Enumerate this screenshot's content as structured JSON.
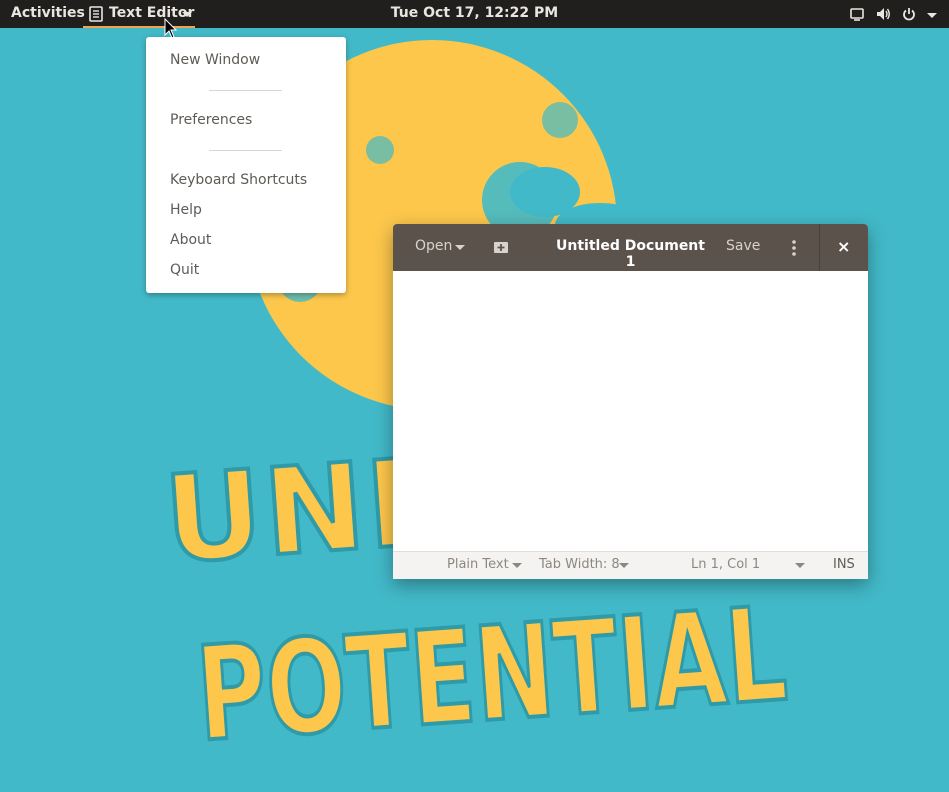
{
  "topbar": {
    "activities": "Activities",
    "app_name": "Text Editor",
    "clock": "Tue Oct 17, 12:22 PM",
    "tray_icons": [
      "display-icon",
      "volume-icon",
      "power-icon"
    ],
    "accent_color": "#f0a44c"
  },
  "app_menu": {
    "items": [
      "New Window",
      "Preferences",
      "Keyboard Shortcuts",
      "Help",
      "About",
      "Quit"
    ]
  },
  "editor": {
    "open_label": "Open",
    "title": "Untitled Document 1",
    "save_label": "Save",
    "close_glyph": "×",
    "status": {
      "language": "Plain Text",
      "tab_width": "Tab Width: 8",
      "position": "Ln 1, Col 1",
      "mode": "INS"
    },
    "headerbar_color": "#5c524c"
  },
  "wallpaper": {
    "background_color": "#42b9c8",
    "art_color": "#fcc74b",
    "text_line1": "UNLE",
    "text_line2": "POTENTIAL"
  }
}
